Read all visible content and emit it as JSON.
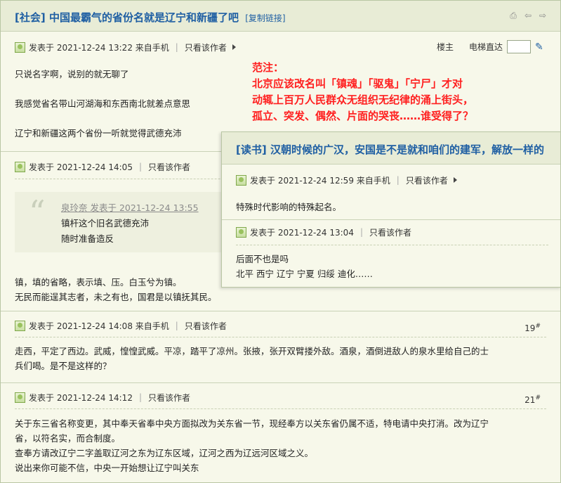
{
  "thread": {
    "category": "[社会]",
    "title": "中国最霸气的省份名就是辽宁和新疆了吧",
    "copy_link": "[复制链接]"
  },
  "toolbar_icons": [
    "printer-icon",
    "prev-icon",
    "next-icon"
  ],
  "floor_tools": {
    "owner_label": "楼主",
    "jump_label": "电梯直达",
    "jump_value": ""
  },
  "posts": [
    {
      "meta": "发表于 2021-12-24 13:22 来自手机",
      "only_author": "只看该作者",
      "lines": [
        "只说名字啊，说别的就无聊了",
        "我感觉省名带山河湖海和东西南北就差点意思",
        "辽宁和新疆这两个省份一听就觉得武德充沛"
      ]
    },
    {
      "meta": "发表于 2021-12-24 14:05",
      "only_author": "只看该作者",
      "quote": {
        "author": "泉玲奈 发表于 2021-12-24 13:55",
        "lines": [
          "镇杆这个旧名武德充沛",
          "随时准备造反"
        ]
      },
      "lines": [
        "镇，填的省略，表示填、压。白玉兮为镇。",
        "无民而能逞其志者，未之有也，国君是以镇抚其民。"
      ]
    },
    {
      "meta": "发表于 2021-12-24 14:08 来自手机",
      "only_author": "只看该作者",
      "floor": "19",
      "lines": [
        "走西，平定了西边。武威，惶惶武威。平凉，踏平了凉州。张掖，张开双臂搂外敌。酒泉，酒倒进敌人的泉水里给自己的士",
        "兵们喝。是不是这样的？"
      ]
    },
    {
      "meta": "发表于 2021-12-24 14:12",
      "only_author": "只看该作者",
      "floor": "21",
      "lines": [
        "关于东三省名称变更，其中奉天省奉中央方面拟改为关东省一节，现经奉方以关东省仍属不适，特电请中央打消。改为辽宁",
        "省，以符名实，而合制度。",
        "查奉方请改辽宁二字盖取辽河之东为辽东区域，辽河之西为辽远河区域之义。",
        "说出来你可能不信，中央一开始想让辽宁叫关东"
      ]
    }
  ],
  "annotation": {
    "lines": [
      "范注：",
      "北京应该改名叫「镇魂」「驱鬼」「宁尸」才对",
      "动辄上百万人民群众无组织无纪律的涌上街头，",
      "孤立、突发、偶然、片面的哭丧……谁受得了？"
    ]
  },
  "overlay": {
    "category": "[读书]",
    "title": "汉朝时候的广汉，安国是不是就和咱们的建军，解放一样的",
    "posts": [
      {
        "meta": "发表于 2021-12-24 12:59 来自手机",
        "only_author": "只看该作者",
        "lines": [
          "特殊时代影响的特殊起名。"
        ]
      },
      {
        "meta": "发表于 2021-12-24 13:04",
        "only_author": "只看该作者",
        "lines": [
          "后面不也是吗",
          "北平 西宁 辽宁 宁夏 归绥 迪化……"
        ]
      }
    ]
  }
}
